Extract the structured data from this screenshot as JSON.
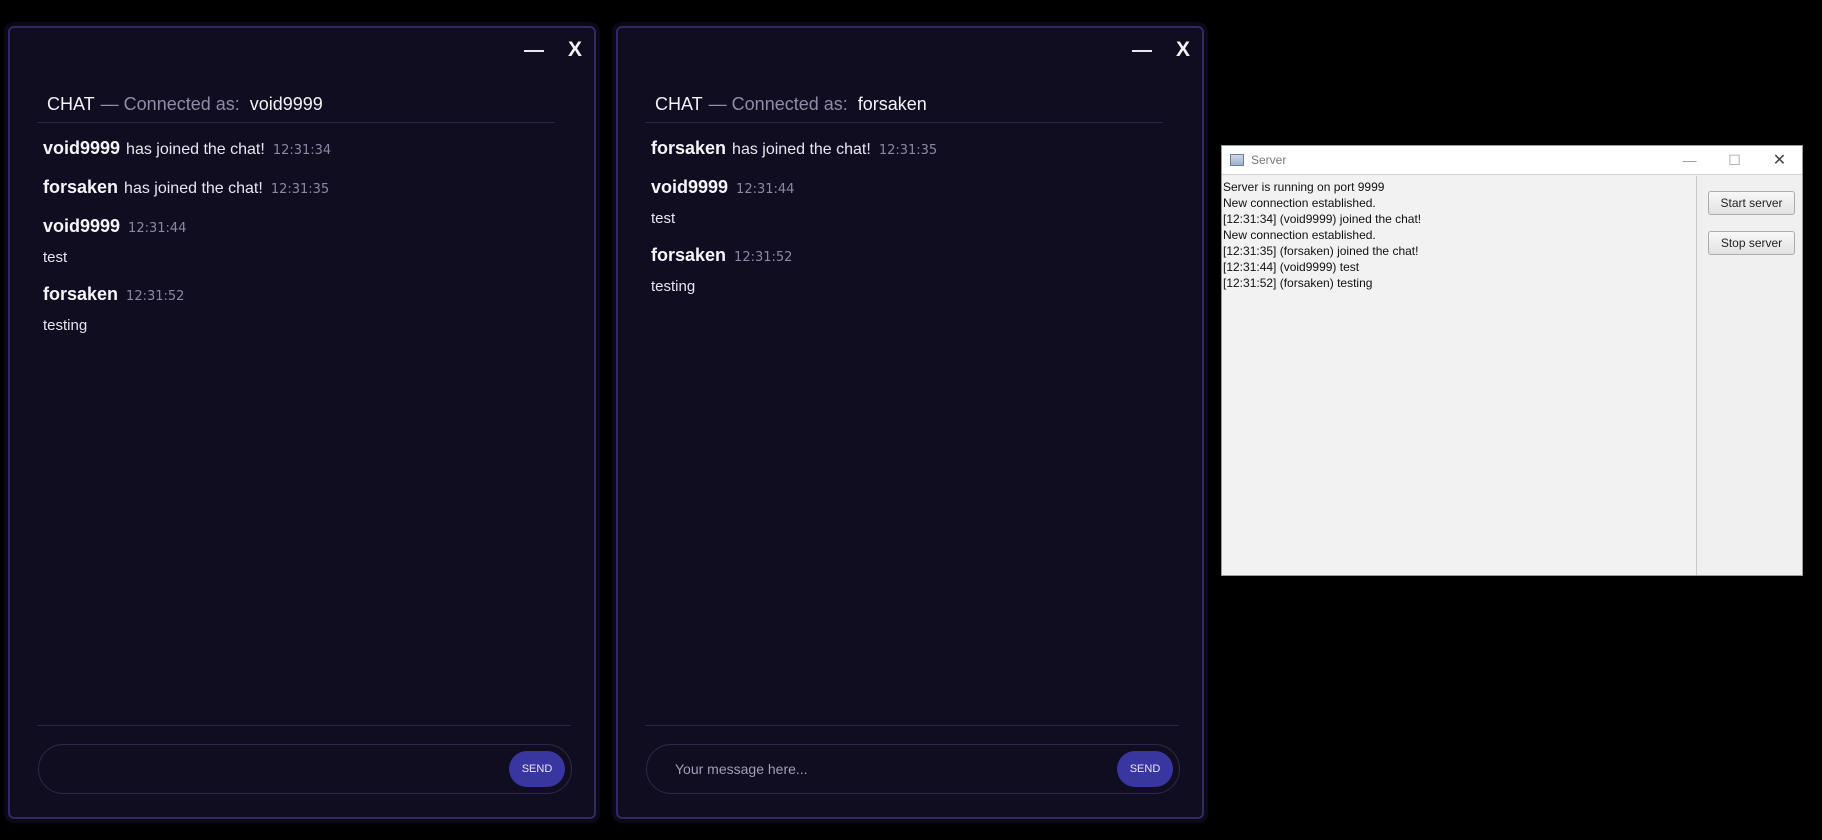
{
  "chat_windows": [
    {
      "controls": {
        "minimize": "—",
        "close": "X"
      },
      "header": {
        "title": "CHAT",
        "separator": "— Connected as:",
        "user": "void9999"
      },
      "messages": [
        {
          "user": "void9999",
          "system": "has joined the chat!",
          "time": "12:31:34"
        },
        {
          "user": "forsaken",
          "system": "has joined the chat!",
          "time": "12:31:35"
        },
        {
          "user": "void9999",
          "time": "12:31:44",
          "body": "test"
        },
        {
          "user": "forsaken",
          "time": "12:31:52",
          "body": "testing"
        }
      ],
      "composer": {
        "value": "",
        "placeholder": "",
        "send_label": "SEND"
      }
    },
    {
      "controls": {
        "minimize": "—",
        "close": "X"
      },
      "header": {
        "title": "CHAT",
        "separator": "— Connected as:",
        "user": "forsaken"
      },
      "messages": [
        {
          "user": "forsaken",
          "system": "has joined the chat!",
          "time": "12:31:35"
        },
        {
          "user": "void9999",
          "time": "12:31:44",
          "body": "test"
        },
        {
          "user": "forsaken",
          "time": "12:31:52",
          "body": "testing"
        }
      ],
      "composer": {
        "value": "",
        "placeholder": "Your message here...",
        "send_label": "SEND"
      }
    }
  ],
  "server": {
    "title": "Server",
    "titlebar_buttons": {
      "minimize": "—",
      "maximize": "☐",
      "close": "✕"
    },
    "log": [
      "Server is running on port 9999",
      "New connection established.",
      "[12:31:34] (void9999) joined the chat!",
      "New connection established.",
      "[12:31:35] (forsaken) joined the chat!",
      "[12:31:44] (void9999) test",
      "[12:31:52] (forsaken) testing"
    ],
    "start_label": "Start server",
    "stop_label": "Stop server"
  },
  "colors": {
    "chat_bg": "#0f0d1f",
    "accent": "#3a36a0",
    "border": "#2f2a60"
  }
}
